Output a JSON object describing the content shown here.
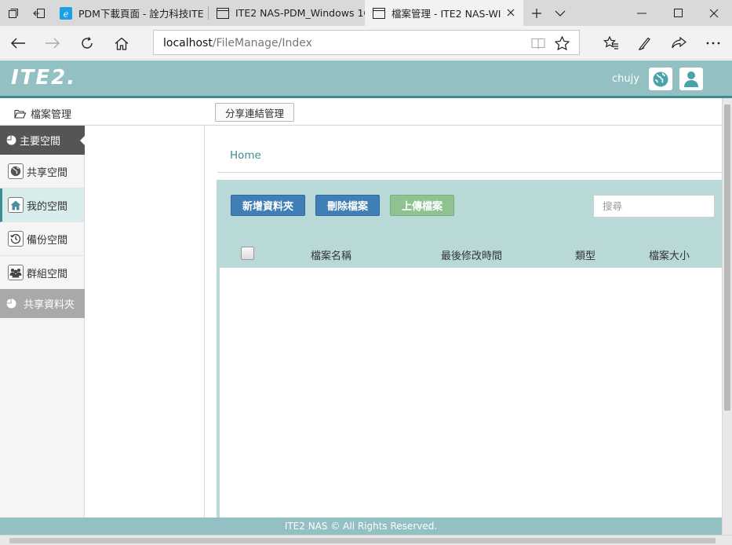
{
  "browser": {
    "tabs": [
      {
        "title": "PDM下載頁面 - 詮力科技ITE",
        "icon": "edge-page-icon"
      },
      {
        "title": "ITE2 NAS-PDM_Windows 1C",
        "icon": "page-icon"
      },
      {
        "title": "檔案管理 - ITE2 NAS-WI",
        "icon": "page-icon",
        "active": true
      }
    ],
    "address": {
      "host": "localhost",
      "path": "/FileManage/Index"
    }
  },
  "app": {
    "logo": "ITE2.",
    "user": "chujy",
    "header_icons": [
      "globe-icon",
      "user-icon"
    ],
    "accent_color": "#92c0c3"
  },
  "subheader": {
    "title": "檔案管理",
    "share_button": "分享連結管理"
  },
  "sidebar": {
    "main_header": "主要空間",
    "items": [
      {
        "label": "共享空間",
        "icon": "globe-icon"
      },
      {
        "label": "我的空間",
        "icon": "home-icon",
        "active": true
      },
      {
        "label": "備份空間",
        "icon": "history-icon"
      },
      {
        "label": "群組空間",
        "icon": "users-icon"
      }
    ],
    "shared_header": "共享資料夾"
  },
  "main": {
    "breadcrumb": "Home",
    "buttons": {
      "new_folder": "新增資料夾",
      "delete": "刪除檔案",
      "upload": "上傳檔案"
    },
    "search_placeholder": "搜尋",
    "columns": [
      "檔案名稱",
      "最後修改時間",
      "類型",
      "檔案大小"
    ]
  },
  "footer": {
    "text": "ITE2 NAS © All Rights Reserved."
  }
}
